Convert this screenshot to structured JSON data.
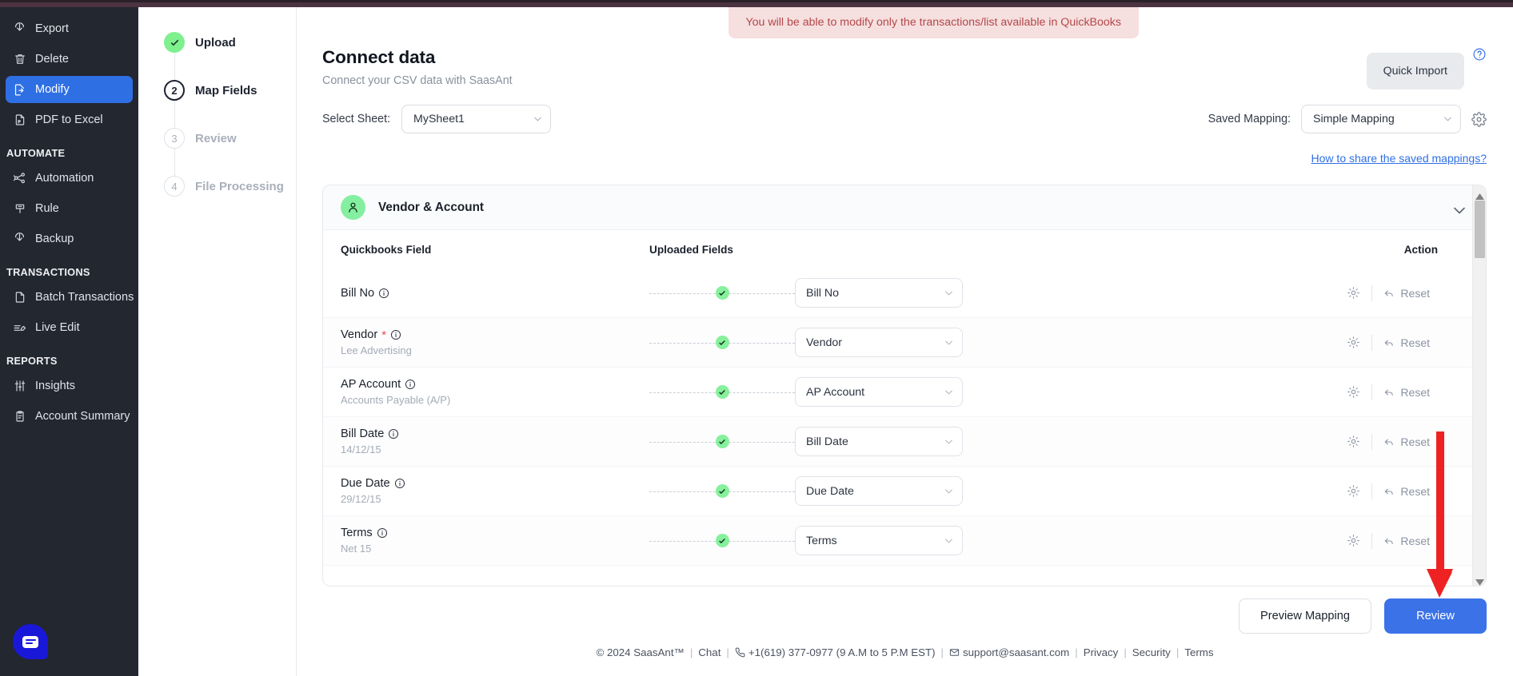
{
  "sidebar": {
    "items": [
      {
        "label": "Export",
        "icon": "export-icon",
        "active": false
      },
      {
        "label": "Delete",
        "icon": "trash-icon",
        "active": false
      },
      {
        "label": "Modify",
        "icon": "file-edit-icon",
        "active": true
      },
      {
        "label": "PDF to Excel",
        "icon": "pdf-file-icon",
        "active": false
      }
    ],
    "sections": [
      {
        "title": "AUTOMATE",
        "items": [
          {
            "label": "Automation",
            "icon": "automation-icon"
          },
          {
            "label": "Rule",
            "icon": "rule-icon"
          },
          {
            "label": "Backup",
            "icon": "backup-icon"
          }
        ]
      },
      {
        "title": "TRANSACTIONS",
        "items": [
          {
            "label": "Batch Transactions",
            "icon": "document-icon"
          },
          {
            "label": "Live Edit",
            "icon": "live-edit-icon"
          }
        ]
      },
      {
        "title": "REPORTS",
        "items": [
          {
            "label": "Insights",
            "icon": "sliders-icon"
          },
          {
            "label": "Account Summary",
            "icon": "clipboard-icon"
          }
        ]
      }
    ],
    "chat_icon": "chat-bubble-icon"
  },
  "stepper": {
    "steps": [
      {
        "num": "✓",
        "label": "Upload",
        "state": "done"
      },
      {
        "num": "2",
        "label": "Map Fields",
        "state": "current"
      },
      {
        "num": "3",
        "label": "Review",
        "state": "todo"
      },
      {
        "num": "4",
        "label": "File Processing",
        "state": "todo"
      }
    ]
  },
  "banner": {
    "text": "You will be able to modify only the transactions/list available in QuickBooks"
  },
  "header": {
    "title": "Connect data",
    "subtitle": "Connect your CSV data with SaasAnt",
    "quick_import_label": "Quick Import",
    "help_icon": "help-circle-icon"
  },
  "controls": {
    "select_sheet_label": "Select Sheet:",
    "select_sheet_value": "MySheet1",
    "saved_mapping_label": "Saved Mapping:",
    "saved_mapping_value": "Simple Mapping",
    "settings_icon": "gear-icon",
    "share_link": "How to share the saved mappings?"
  },
  "mapping": {
    "section_title": "Vendor & Account",
    "section_icon": "person-icon",
    "collapse_icon": "chevron-down-icon",
    "columns": {
      "quickbooks_field": "Quickbooks Field",
      "uploaded_fields": "Uploaded Fields",
      "action": "Action"
    },
    "reset_label": "Reset",
    "rows": [
      {
        "qb_field": "Bill No",
        "required": false,
        "sample": "",
        "mapped_value": "Bill No",
        "status": "mapped"
      },
      {
        "qb_field": "Vendor",
        "required": true,
        "sample": "Lee Advertising",
        "mapped_value": "Vendor",
        "status": "mapped"
      },
      {
        "qb_field": "AP Account",
        "required": false,
        "sample": "Accounts Payable (A/P)",
        "mapped_value": "AP Account",
        "status": "mapped"
      },
      {
        "qb_field": "Bill Date",
        "required": false,
        "sample": "14/12/15",
        "mapped_value": "Bill Date",
        "status": "mapped"
      },
      {
        "qb_field": "Due Date",
        "required": false,
        "sample": "29/12/15",
        "mapped_value": "Due Date",
        "status": "mapped"
      },
      {
        "qb_field": "Terms",
        "required": false,
        "sample": "Net 15",
        "mapped_value": "Terms",
        "status": "mapped"
      }
    ]
  },
  "actions": {
    "preview_label": "Preview Mapping",
    "review_label": "Review"
  },
  "footer": {
    "copyright": "© 2024 SaasAnt™",
    "chat": "Chat",
    "phone": "+1(619) 377-0977 (9 A.M to 5 P.M EST)",
    "email": "support@saasant.com",
    "privacy": "Privacy",
    "security": "Security",
    "terms": "Terms"
  },
  "colors": {
    "accent_blue": "#3b72e8",
    "sidebar_bg": "#232730",
    "success_green": "#86f09c",
    "banner_bg": "#f6dfdf",
    "banner_text": "#b3484a",
    "annotation_red": "#ee2222"
  }
}
